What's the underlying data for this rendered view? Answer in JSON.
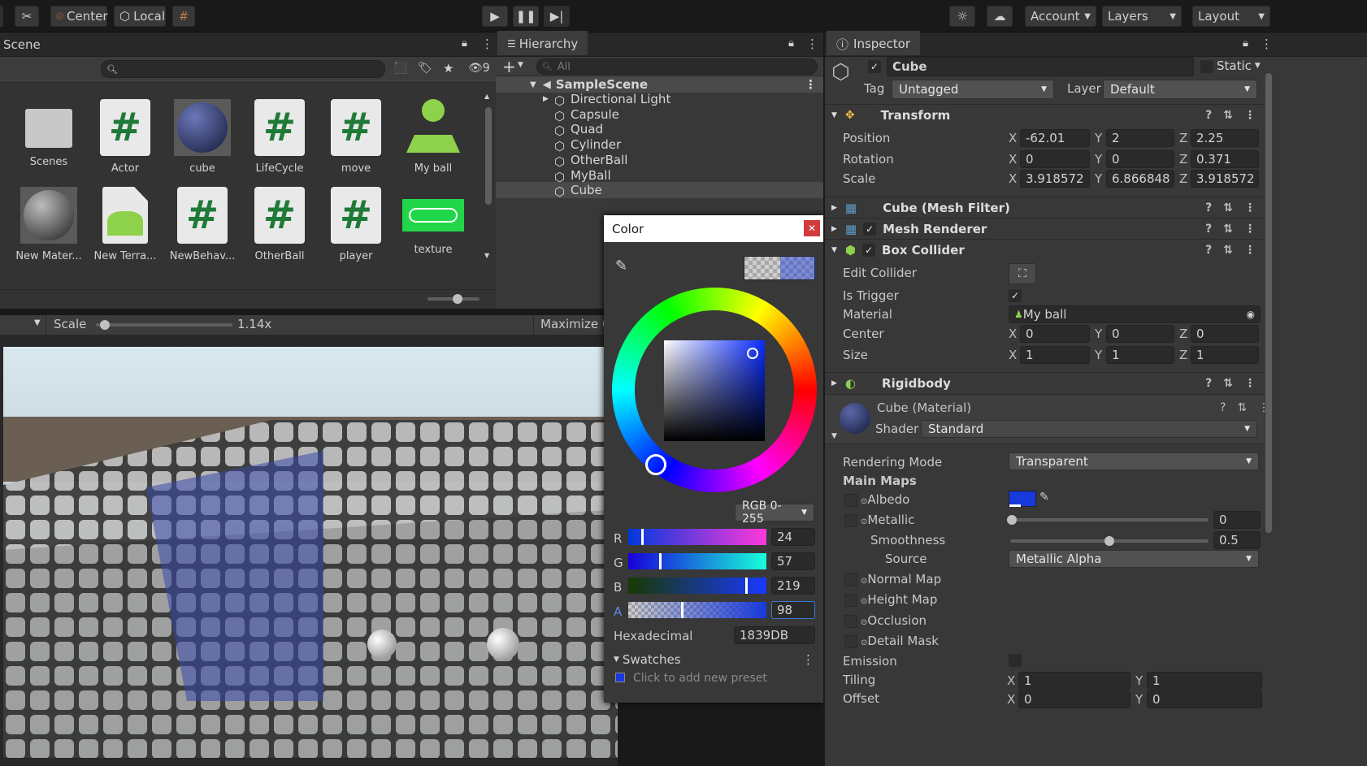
{
  "toolbar": {
    "pivot": "Center",
    "space": "Local",
    "account": "Account",
    "layers": "Layers",
    "layout": "Layout"
  },
  "project": {
    "tab": "Scene",
    "hidden_count": "9",
    "assets": [
      {
        "name": "Scenes",
        "kind": "folder"
      },
      {
        "name": "Actor",
        "kind": "script"
      },
      {
        "name": "cube",
        "kind": "material"
      },
      {
        "name": "LifeCycle",
        "kind": "script"
      },
      {
        "name": "move",
        "kind": "script"
      },
      {
        "name": "My ball",
        "kind": "physic"
      },
      {
        "name": "New Mater...",
        "kind": "material-gray"
      },
      {
        "name": "New Terra...",
        "kind": "terrain"
      },
      {
        "name": "NewBehav...",
        "kind": "script"
      },
      {
        "name": "OtherBall",
        "kind": "script"
      },
      {
        "name": "player",
        "kind": "script"
      },
      {
        "name": "texture",
        "kind": "texture"
      }
    ]
  },
  "gameview": {
    "scale_label": "Scale",
    "scale_value": "1.14x",
    "maximize": "Maximize C"
  },
  "hierarchy": {
    "tab": "Hierarchy",
    "search_placeholder": "All",
    "scene": "SampleScene",
    "items": [
      "Directional Light",
      "Capsule",
      "Quad",
      "Cylinder",
      "OtherBall",
      "MyBall",
      "Cube"
    ],
    "selected": "Cube"
  },
  "color_picker": {
    "title": "Color",
    "mode": "RGB 0-255",
    "r": "24",
    "g": "57",
    "b": "219",
    "a": "98",
    "hex_label": "Hexadecimal",
    "hex": "1839DB",
    "swatches": "Swatches",
    "add_preset": "Click to add new preset",
    "color": "#1839db"
  },
  "inspector": {
    "tab": "Inspector",
    "object_name": "Cube",
    "static_label": "Static",
    "tag_label": "Tag",
    "tag": "Untagged",
    "layer_label": "Layer",
    "layer": "Default",
    "transform": {
      "title": "Transform",
      "position_label": "Position",
      "rotation_label": "Rotation",
      "scale_label": "Scale",
      "position": [
        "-62.01",
        "2",
        "2.25"
      ],
      "rotation": [
        "0",
        "0",
        "0.371"
      ],
      "scale": [
        "3.918572",
        "6.866848",
        "3.918572"
      ]
    },
    "mesh_filter": "Cube (Mesh Filter)",
    "mesh_renderer": "Mesh Renderer",
    "box_collider": {
      "title": "Box Collider",
      "edit_collider": "Edit Collider",
      "is_trigger": "Is Trigger",
      "material_label": "Material",
      "material": "My ball",
      "center_label": "Center",
      "center": [
        "0",
        "0",
        "0"
      ],
      "size_label": "Size",
      "size": [
        "1",
        "1",
        "1"
      ]
    },
    "rigidbody": "Rigidbody",
    "material": {
      "title": "Cube (Material)",
      "shader_label": "Shader",
      "shader": "Standard",
      "rendering_mode_label": "Rendering Mode",
      "rendering_mode": "Transparent",
      "main_maps": "Main Maps",
      "albedo": "Albedo",
      "metallic": "Metallic",
      "metallic_value": "0",
      "smoothness": "Smoothness",
      "smoothness_value": "0.5",
      "source_label": "Source",
      "source": "Metallic Alpha",
      "normal_map": "Normal Map",
      "height_map": "Height Map",
      "occlusion": "Occlusion",
      "detail_mask": "Detail Mask",
      "emission": "Emission",
      "tiling_label": "Tiling",
      "tiling": [
        "1",
        "1"
      ],
      "offset_label": "Offset",
      "offset": [
        "0",
        "0"
      ]
    }
  }
}
